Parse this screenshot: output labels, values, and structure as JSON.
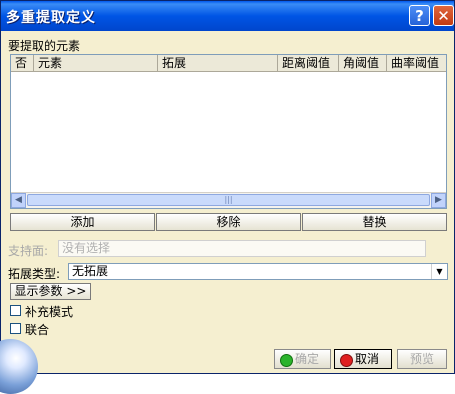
{
  "window": {
    "title": "多重提取定义",
    "help_label": "?",
    "close_label": "✕"
  },
  "group": {
    "label": "要提取的元素"
  },
  "table": {
    "columns": [
      "否",
      "元素",
      "拓展",
      "距离阈值",
      "角阈值",
      "曲率阈值"
    ],
    "rows": []
  },
  "scrollbar": {
    "left_arrow": "◀",
    "right_arrow": "▶",
    "grip": "|||"
  },
  "actions": {
    "add": "添加",
    "remove": "移除",
    "replace": "替换"
  },
  "support": {
    "label": "支持面:",
    "value": "没有选择"
  },
  "ext_type": {
    "label": "拓展类型:",
    "value": "无拓展",
    "arrow": "▼"
  },
  "show_params": "显示参数 >>",
  "options": {
    "complement_mode": "补充模式",
    "federation": "联合"
  },
  "footer": {
    "ok": "确定",
    "cancel": "取消",
    "preview": "预览"
  },
  "colors": {
    "title_bar": "#0055e5",
    "panel": "#f5efd0",
    "ok_dot": "#2bb32b",
    "cancel_dot": "#e02020"
  }
}
